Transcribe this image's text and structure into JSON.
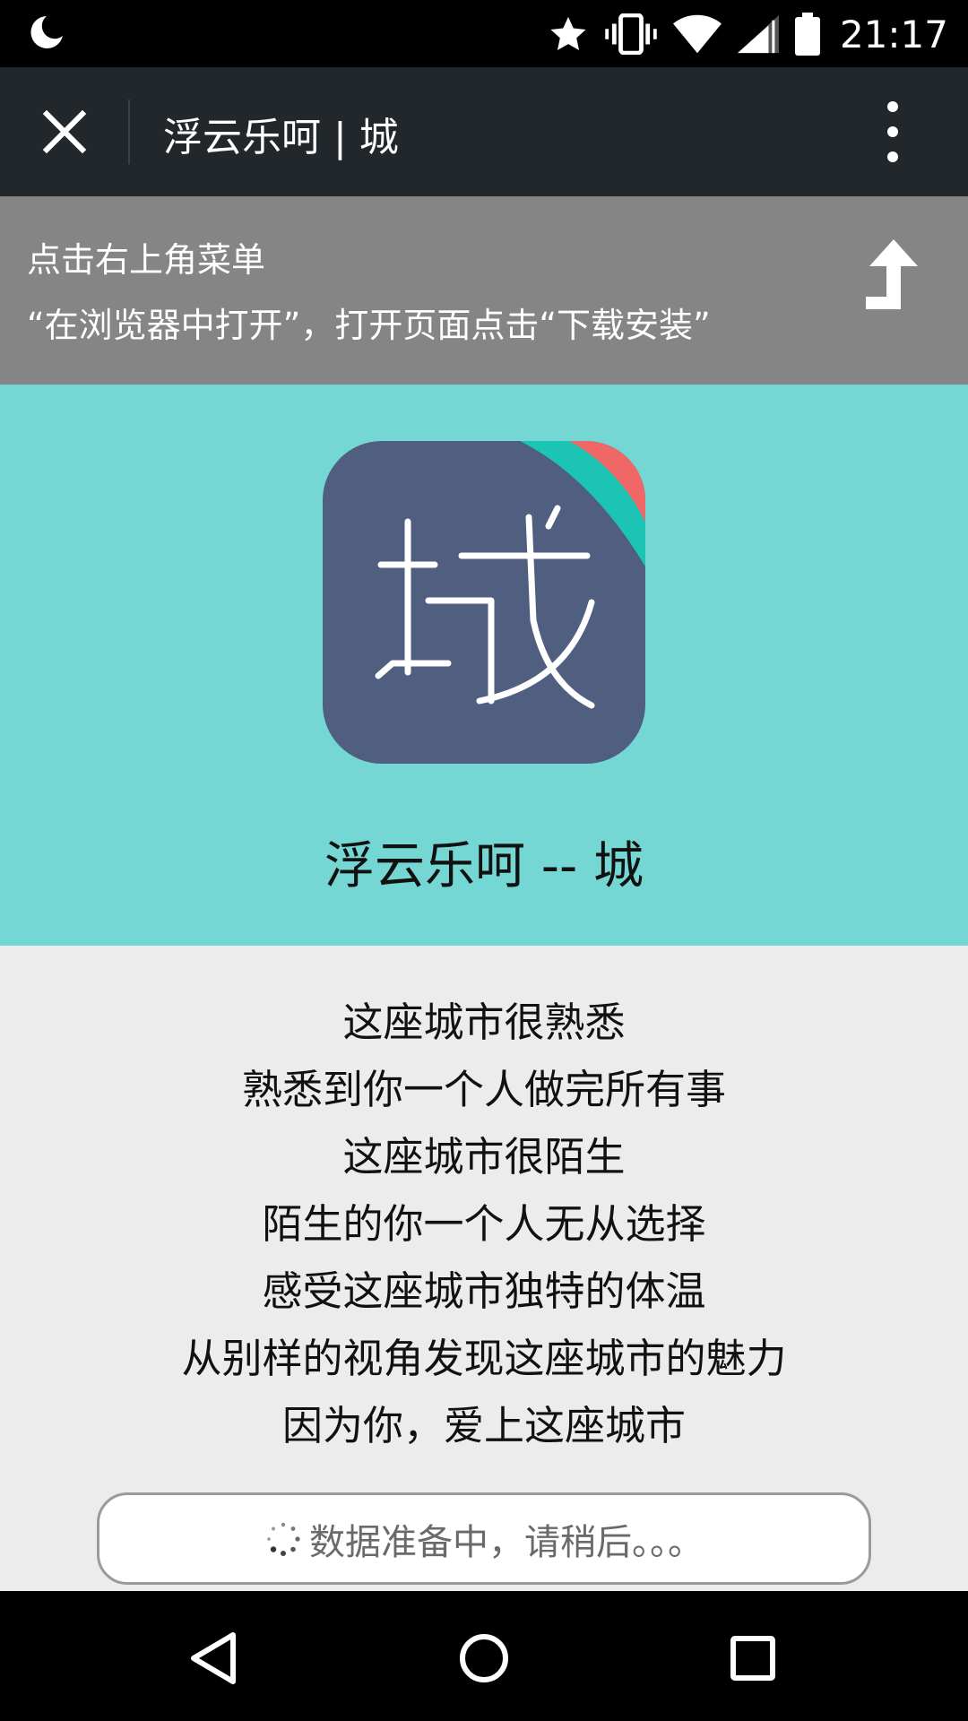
{
  "status_bar": {
    "time": "21:17",
    "icons": [
      "moon-icon",
      "star-icon",
      "vibrate-icon",
      "wifi-icon",
      "signal-icon",
      "battery-icon"
    ]
  },
  "app_bar": {
    "title": "浮云乐呵 | 城"
  },
  "hint": {
    "line1": "点击右上角菜单",
    "line2": "“在浏览器中打开”，打开页面点击“下载安装”"
  },
  "app": {
    "icon_glyph": "城",
    "name": "浮云乐呵 -- 城",
    "colors": {
      "hero_bg": "#74d7d4",
      "icon_bg": "#505e80",
      "ribbon_teal": "#1cc5b3",
      "ribbon_red": "#f06767"
    }
  },
  "description": {
    "lines": [
      "这座城市很熟悉",
      "熟悉到你一个人做完所有事",
      "这座城市很陌生",
      "陌生的你一个人无从选择",
      "感受这座城市独特的体温",
      "从别样的视角发现这座城市的魅力",
      "因为你，爱上这座城市"
    ]
  },
  "loading": {
    "text": "数据准备中，请稍后。。。"
  }
}
